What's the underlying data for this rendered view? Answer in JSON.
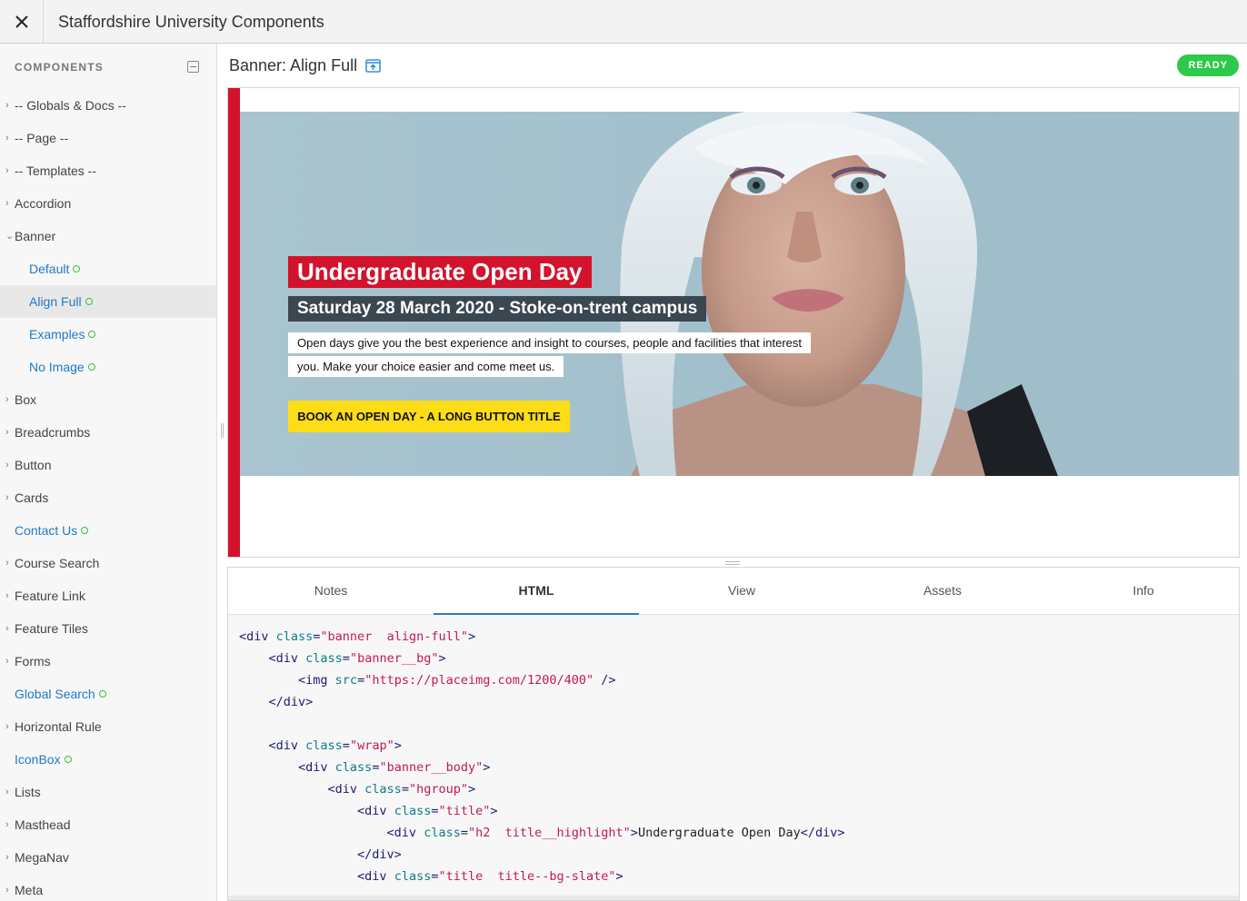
{
  "app": {
    "title": "Staffordshire University Components"
  },
  "sidebar": {
    "title": "COMPONENTS",
    "items": [
      {
        "label": "-- Globals & Docs --",
        "type": "collapsed"
      },
      {
        "label": "-- Page --",
        "type": "collapsed"
      },
      {
        "label": "-- Templates --",
        "type": "collapsed"
      },
      {
        "label": "Accordion",
        "type": "collapsed"
      },
      {
        "label": "Banner",
        "type": "expanded"
      },
      {
        "label": "Default",
        "type": "sub",
        "status": true
      },
      {
        "label": "Align Full",
        "type": "sub",
        "status": true,
        "active": true
      },
      {
        "label": "Examples",
        "type": "sub",
        "status": true
      },
      {
        "label": "No Image",
        "type": "sub",
        "status": true
      },
      {
        "label": "Box",
        "type": "collapsed"
      },
      {
        "label": "Breadcrumbs",
        "type": "collapsed"
      },
      {
        "label": "Button",
        "type": "collapsed"
      },
      {
        "label": "Cards",
        "type": "collapsed"
      },
      {
        "label": "Contact Us",
        "type": "link",
        "status": true
      },
      {
        "label": "Course Search",
        "type": "collapsed"
      },
      {
        "label": "Feature Link",
        "type": "collapsed"
      },
      {
        "label": "Feature Tiles",
        "type": "collapsed"
      },
      {
        "label": "Forms",
        "type": "collapsed"
      },
      {
        "label": "Global Search",
        "type": "link",
        "status": true
      },
      {
        "label": "Horizontal Rule",
        "type": "collapsed"
      },
      {
        "label": "IconBox",
        "type": "link",
        "status": true
      },
      {
        "label": "Lists",
        "type": "collapsed"
      },
      {
        "label": "Masthead",
        "type": "collapsed"
      },
      {
        "label": "MegaNav",
        "type": "collapsed"
      },
      {
        "label": "Meta",
        "type": "collapsed"
      }
    ]
  },
  "main": {
    "component_title": "Banner: Align Full",
    "status": "READY"
  },
  "banner": {
    "title": "Undergraduate Open Day",
    "subtitle": "Saturday 28 March 2020 - Stoke-on-trent campus",
    "text": "Open days give you the best experience and insight to courses, people and facilities that interest you. Make your choice easier and come meet us.",
    "button": "BOOK AN OPEN DAY - A LONG BUTTON TITLE"
  },
  "tabs": [
    {
      "label": "Notes"
    },
    {
      "label": "HTML",
      "active": true
    },
    {
      "label": "View"
    },
    {
      "label": "Assets"
    },
    {
      "label": "Info"
    }
  ],
  "code_lines": [
    [
      [
        "t",
        "<div "
      ],
      [
        "a",
        "class"
      ],
      [
        "t",
        "="
      ],
      [
        "s",
        "\"banner  align-full\""
      ],
      [
        "t",
        ">"
      ]
    ],
    [
      [
        "t",
        "    <div "
      ],
      [
        "a",
        "class"
      ],
      [
        "t",
        "="
      ],
      [
        "s",
        "\"banner__bg\""
      ],
      [
        "t",
        ">"
      ]
    ],
    [
      [
        "t",
        "        <img "
      ],
      [
        "a",
        "src"
      ],
      [
        "t",
        "="
      ],
      [
        "s",
        "\"https://placeimg.com/1200/400\""
      ],
      [
        "t",
        " />"
      ]
    ],
    [
      [
        "t",
        "    </div>"
      ]
    ],
    [
      [
        "t",
        ""
      ]
    ],
    [
      [
        "t",
        "    <div "
      ],
      [
        "a",
        "class"
      ],
      [
        "t",
        "="
      ],
      [
        "s",
        "\"wrap\""
      ],
      [
        "t",
        ">"
      ]
    ],
    [
      [
        "t",
        "        <div "
      ],
      [
        "a",
        "class"
      ],
      [
        "t",
        "="
      ],
      [
        "s",
        "\"banner__body\""
      ],
      [
        "t",
        ">"
      ]
    ],
    [
      [
        "t",
        "            <div "
      ],
      [
        "a",
        "class"
      ],
      [
        "t",
        "="
      ],
      [
        "s",
        "\"hgroup\""
      ],
      [
        "t",
        ">"
      ]
    ],
    [
      [
        "t",
        "                <div "
      ],
      [
        "a",
        "class"
      ],
      [
        "t",
        "="
      ],
      [
        "s",
        "\"title\""
      ],
      [
        "t",
        ">"
      ]
    ],
    [
      [
        "t",
        "                    <div "
      ],
      [
        "a",
        "class"
      ],
      [
        "t",
        "="
      ],
      [
        "s",
        "\"h2  title__highlight\""
      ],
      [
        "t",
        ">"
      ],
      [
        "x",
        "Undergraduate Open Day"
      ],
      [
        "t",
        "</div>"
      ]
    ],
    [
      [
        "t",
        "                </div>"
      ]
    ],
    [
      [
        "t",
        "                <div "
      ],
      [
        "a",
        "class"
      ],
      [
        "t",
        "="
      ],
      [
        "s",
        "\"title  title--bg-slate\""
      ],
      [
        "t",
        ">"
      ]
    ]
  ]
}
